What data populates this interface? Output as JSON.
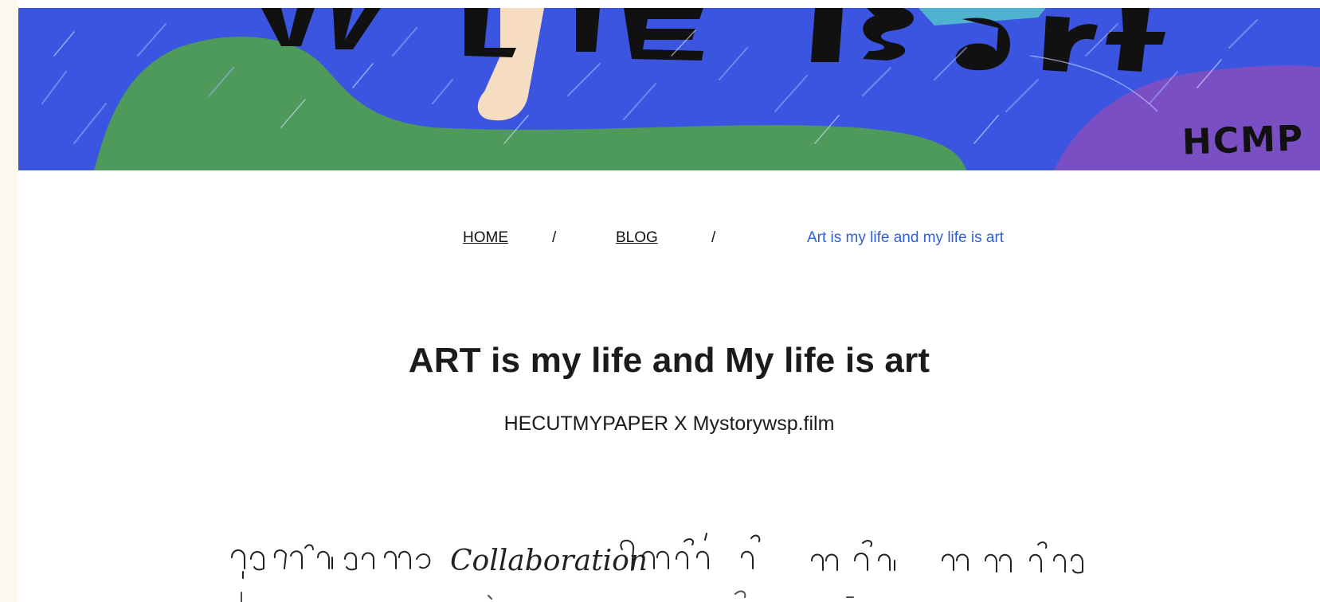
{
  "hero": {
    "image_alt": "",
    "logo_text": "HCMP"
  },
  "breadcrumb": {
    "home": "HOME",
    "separator": "/",
    "blog": "BLOG",
    "current": "Art is my life and my life is art"
  },
  "post": {
    "title": "ART is my life and My life is art",
    "subtitle": "HECUTMYPAPER X Mystorywsp.film"
  },
  "handwriting": {
    "latin_word": "Collaboration"
  },
  "colors": {
    "background": "#fdf8ee",
    "banner_blue": "#3b55e0",
    "banner_green": "#4d9a5a",
    "banner_purple": "#7b4fc4",
    "banner_teal": "#4fb3d0",
    "link_current": "#2f5fd8"
  }
}
